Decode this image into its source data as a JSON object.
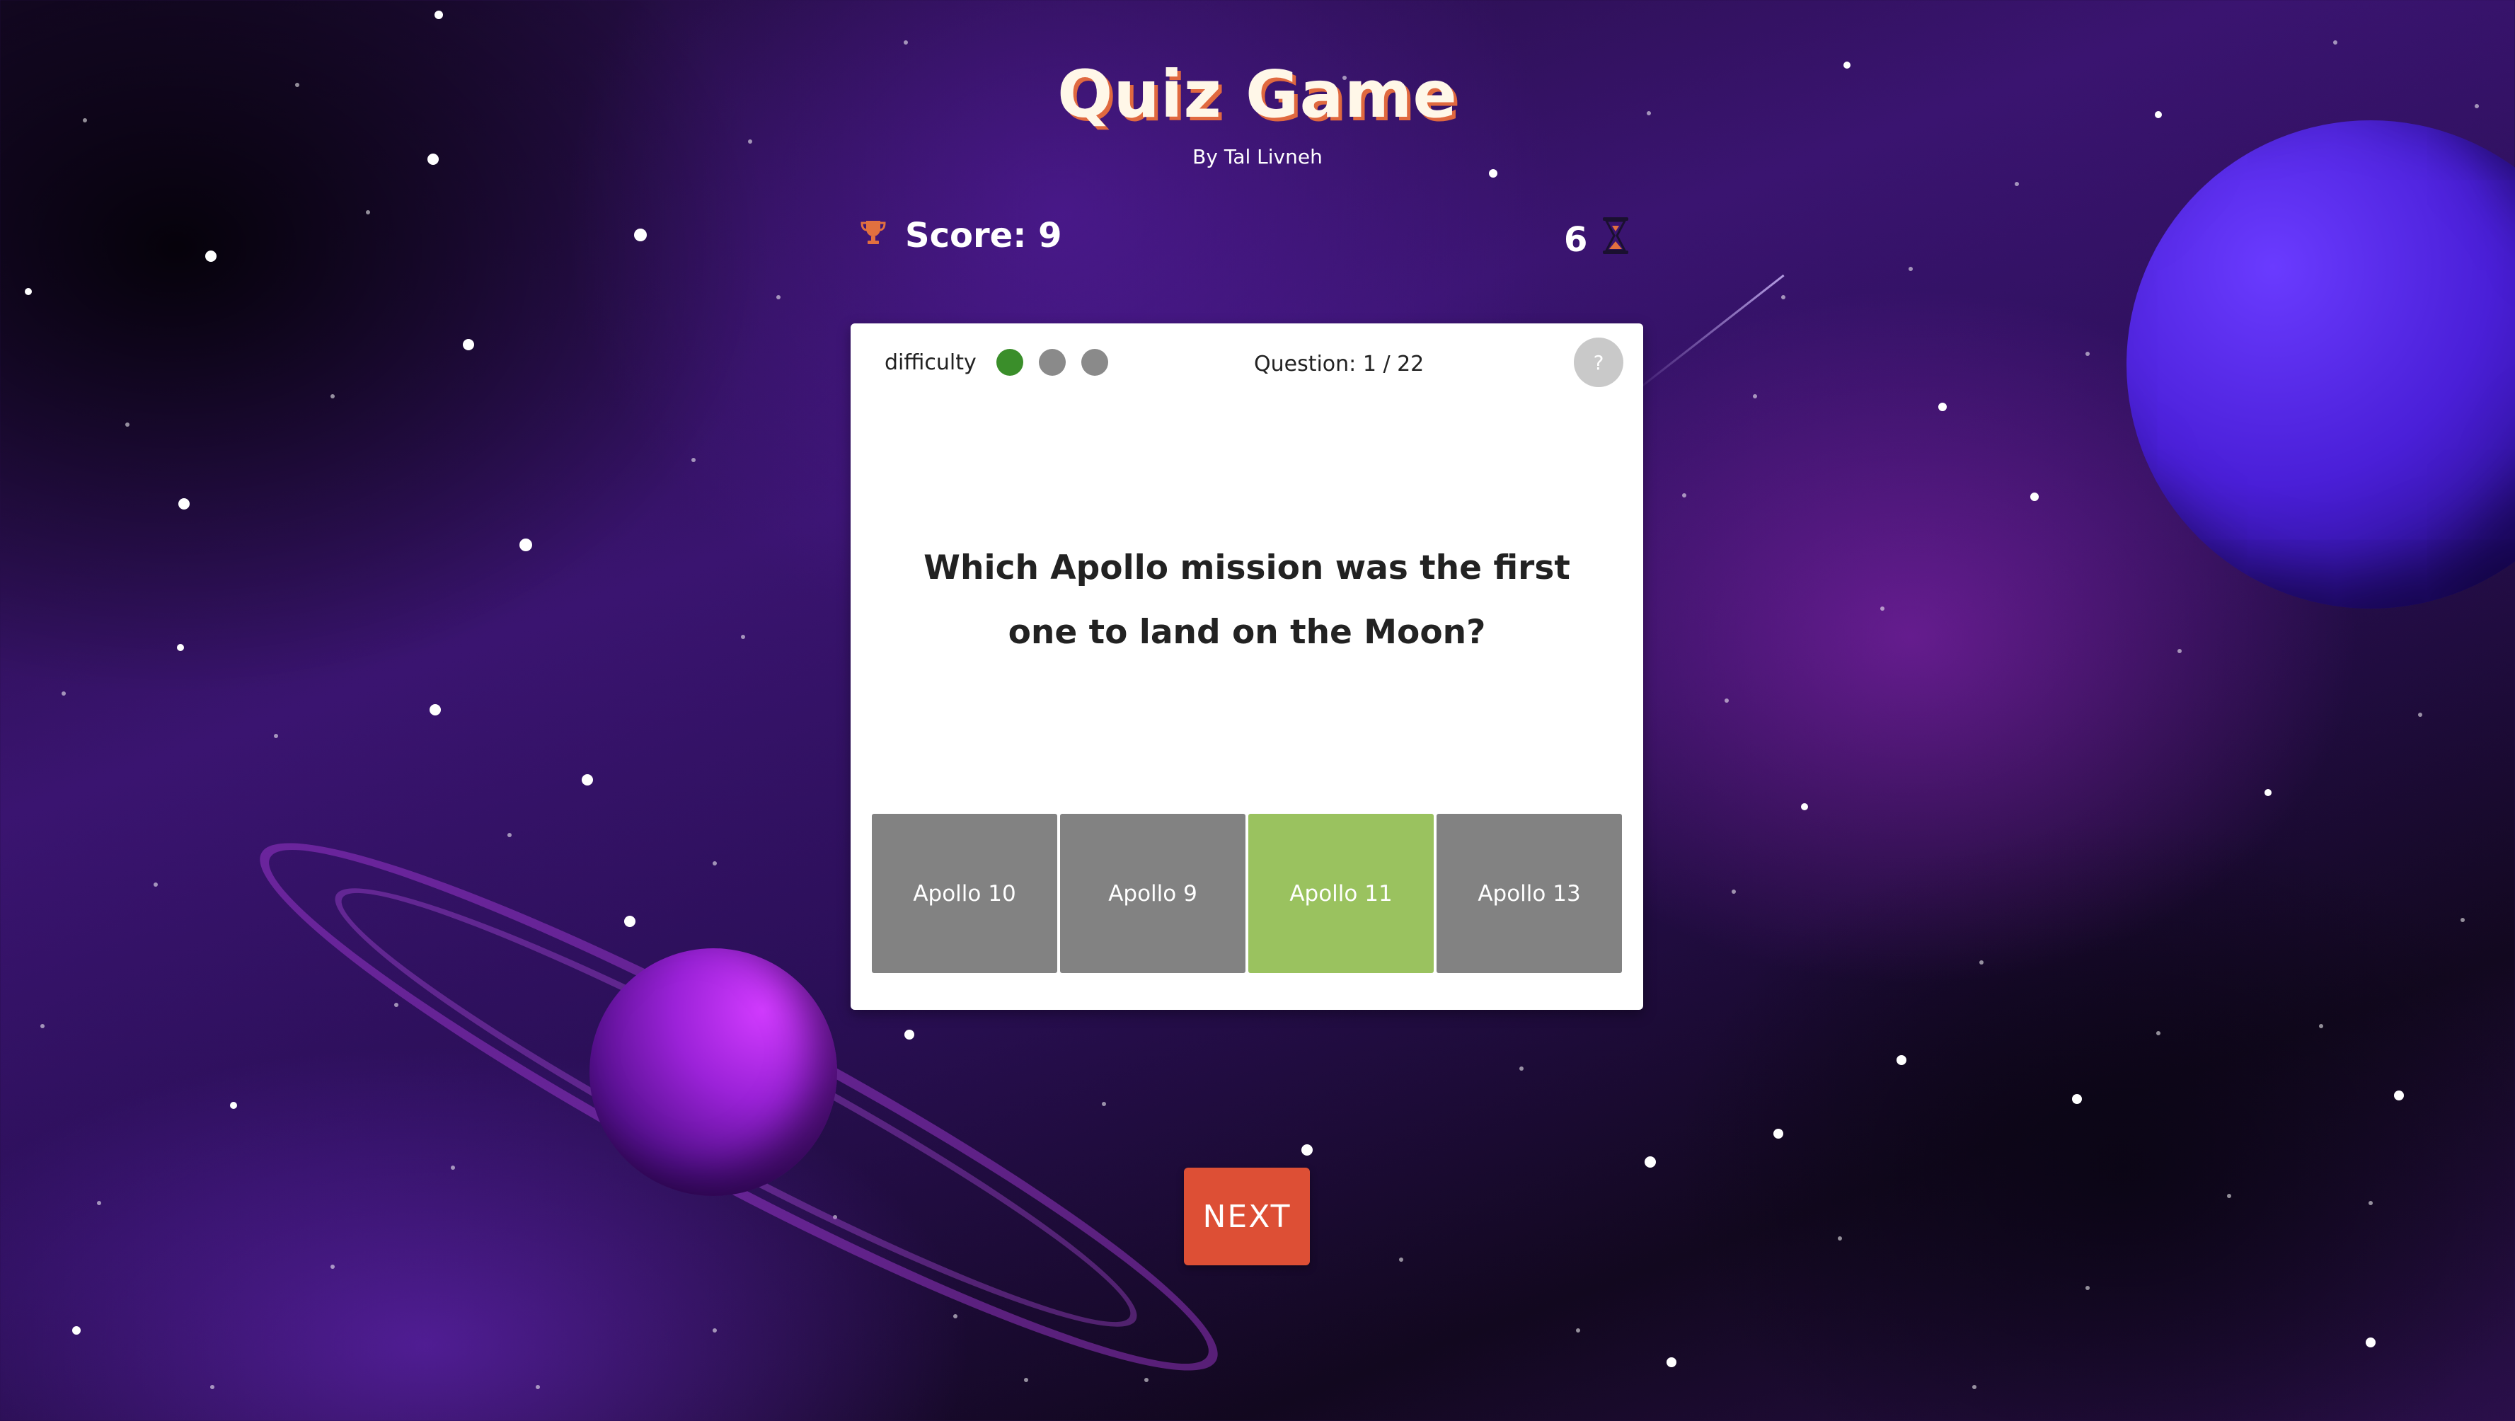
{
  "header": {
    "title": "Quiz Game",
    "author": "By Tal Livneh"
  },
  "status": {
    "score_label": "Score: 9",
    "timer_value": "6",
    "score_icon": "trophy-icon",
    "timer_icon": "hourglass-icon"
  },
  "card": {
    "difficulty_label": "difficulty",
    "difficulty_level": 1,
    "difficulty_max": 3,
    "question_counter": "Question: 1 / 22",
    "help_label": "?",
    "question_text": "Which Apollo mission was the first one to land on the Moon?",
    "answers": [
      {
        "label": "Apollo 10",
        "state": "neutral"
      },
      {
        "label": "Apollo 9",
        "state": "neutral"
      },
      {
        "label": "Apollo 11",
        "state": "correct"
      },
      {
        "label": "Apollo 13",
        "state": "neutral"
      }
    ]
  },
  "next_label": "NEXT",
  "colors": {
    "accent": "#dd4f35",
    "correct": "#9ac25f",
    "neutral_answer": "#828282",
    "difficulty_on": "#3a8e2a",
    "difficulty_off": "#8a8a8a"
  }
}
